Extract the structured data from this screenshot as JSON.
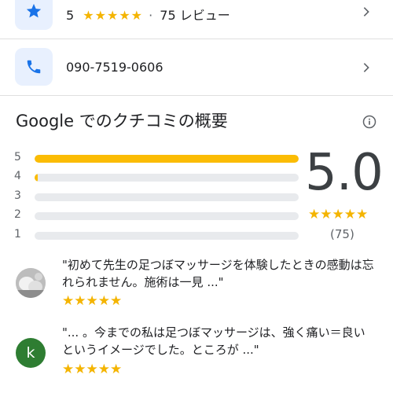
{
  "rating_row": {
    "score": "5",
    "stars": "★★★★★",
    "separator": "·",
    "reviews_label": "75 レビュー",
    "icon": "star-icon"
  },
  "phone_row": {
    "number": "090-7519-0606",
    "icon": "phone-icon"
  },
  "summary": {
    "title": "Google でのクチコミの概要",
    "average": "5.0",
    "stars": "★★★★★",
    "count": "(75)",
    "distribution": [
      {
        "label": "5",
        "fraction": 1.0
      },
      {
        "label": "4",
        "fraction": 0.01
      },
      {
        "label": "3",
        "fraction": 0.0
      },
      {
        "label": "2",
        "fraction": 0.0
      },
      {
        "label": "1",
        "fraction": 0.0
      }
    ]
  },
  "reviews": [
    {
      "text": "\"初めて先生の足つぼマッサージを体験したときの感動は忘れられません。施術は一見 ...\"",
      "stars": "★★★★★",
      "avatar": "photo-avatar"
    },
    {
      "text": "\"... 。今までの私は足つぼマッサージは、強く痛い＝良い　というイメージでした。ところが ...\"",
      "stars": "★★★★★",
      "avatar_letter": "k",
      "avatar_color": "#2e7d32"
    }
  ],
  "colors": {
    "accent_blue": "#1a73e8",
    "star_gold": "#fbbc04",
    "icon_bg": "#e8f0fe"
  }
}
